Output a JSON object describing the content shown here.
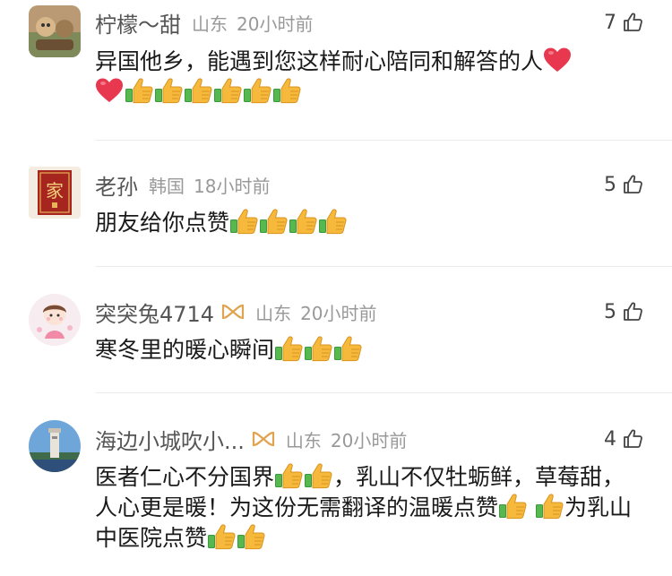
{
  "comments": [
    {
      "name": "柠檬～甜",
      "location": "山东",
      "time": "20小时前",
      "likes": "7",
      "text_a": "异国他乡，能遇到您这样耐心陪同和解答的人",
      "thumbs": 6
    },
    {
      "name": "老孙",
      "location": "韩国",
      "time": "18小时前",
      "likes": "5",
      "avatar_text": "家",
      "text_a": "朋友给你点赞",
      "thumbs": 4
    },
    {
      "name": "突突兔4714",
      "location": "山东",
      "time": "20小时前",
      "likes": "5",
      "text_a": "寒冬里的暖心瞬间",
      "thumbs": 3
    },
    {
      "name": "海边小城吹小...",
      "location": "山东",
      "time": "20小时前",
      "likes": "4",
      "text_a": "医者仁心不分国界",
      "text_b": "，乳山不仅牡蛎鲜，草莓甜，人心更是暖！为这份无需翻译的温暖点赞",
      "text_c": "为乳山中医院点赞"
    }
  ],
  "colors": {
    "name": "#555555",
    "meta": "#999999",
    "heart": "#e8384f",
    "vip": "#e0a450"
  },
  "icons": {
    "like": "thumb-up-outline-icon",
    "emoji_thumb": "thumbs-up-emoji",
    "emoji_heart": "red-heart-emoji",
    "vip": "vip-badge-icon"
  }
}
